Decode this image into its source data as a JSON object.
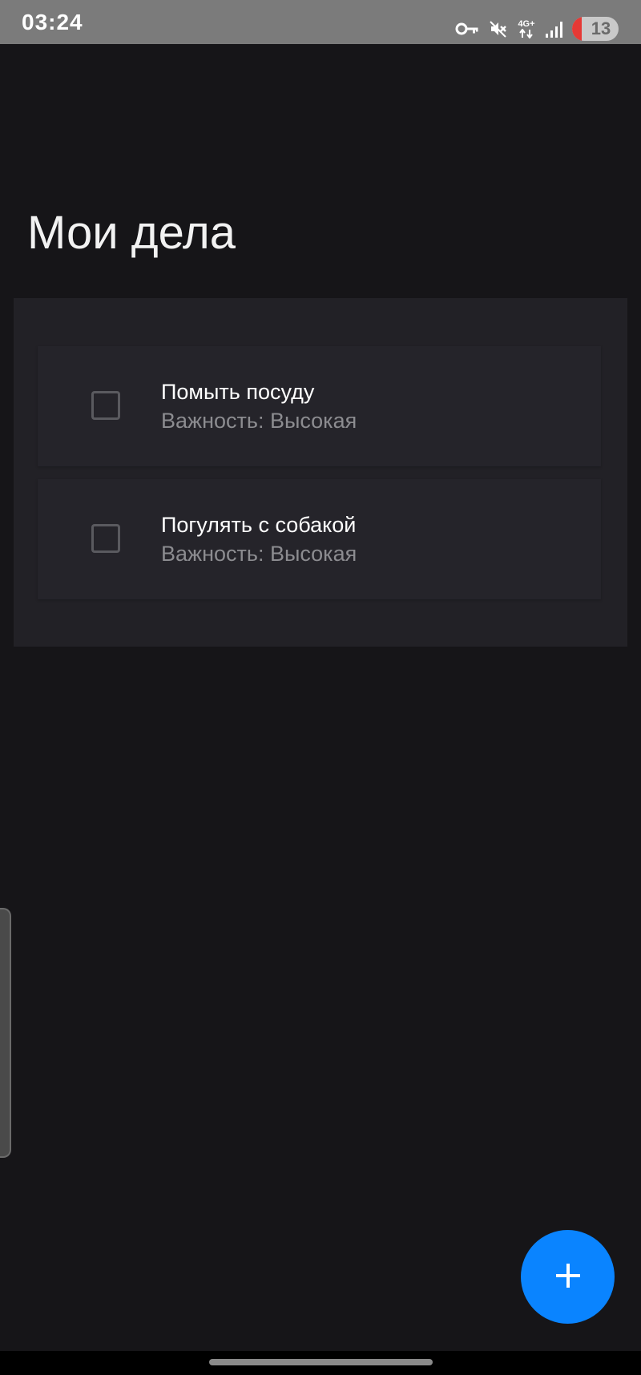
{
  "status_bar": {
    "time": "03:24",
    "network": "4G+",
    "battery": "13",
    "icons": [
      "vpn-key-icon",
      "mute-icon",
      "network-4g-icon",
      "signal-icon",
      "battery-icon"
    ]
  },
  "header": {
    "title": "Мои дела"
  },
  "tasks": [
    {
      "title": "Помыть посуду",
      "priority": "Важность: Высокая",
      "done": false
    },
    {
      "title": "Погулять с собакой",
      "priority": "Важность: Высокая",
      "done": false
    }
  ],
  "fab": {
    "icon": "plus-icon",
    "color": "#0a84ff"
  },
  "colors": {
    "background": "#161518",
    "card": "#222126",
    "accent": "#0a84ff"
  }
}
